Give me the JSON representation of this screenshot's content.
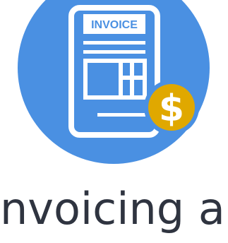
{
  "illustration": {
    "icon": "invoice-icon",
    "badge_icon": "dollar-coin-icon",
    "document_label": "INVOICE",
    "colors": {
      "circle": "#4a90e2",
      "coin": "#e0a800",
      "line": "#ffffff"
    }
  },
  "heading": {
    "text": "nvoicing ar"
  }
}
